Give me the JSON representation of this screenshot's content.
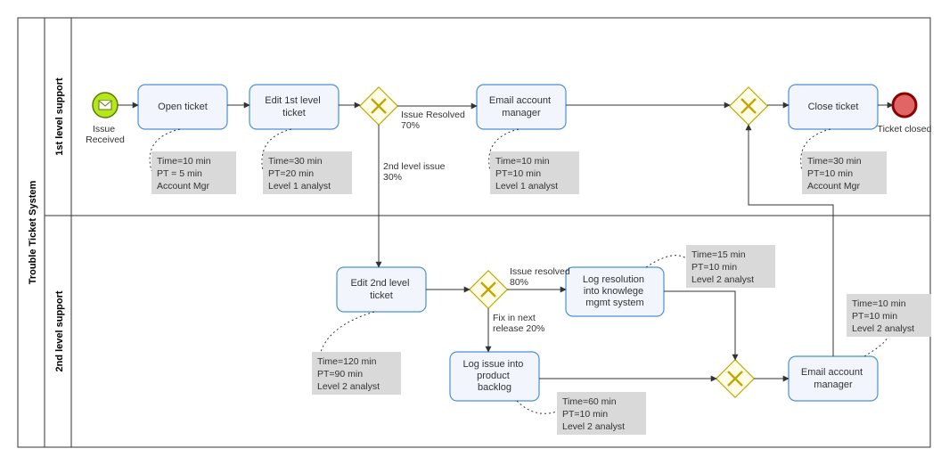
{
  "pool_title": "Trouble Ticket System",
  "lanes": {
    "l1": "1st level support",
    "l2": "2nd level support"
  },
  "start_event": {
    "label": "Issue\nReceived"
  },
  "end_event": {
    "label": "Ticket closed"
  },
  "tasks": {
    "open": {
      "label": "Open ticket",
      "anno": [
        "Time=10 min",
        "PT = 5 min",
        "Account Mgr"
      ]
    },
    "edit1": {
      "label": "Edit 1st level\nticket",
      "anno": [
        "Time=30 min",
        "PT=20 min",
        "Level 1 analyst"
      ]
    },
    "email1": {
      "label": "Email account\nmanager",
      "anno": [
        "Time=10 min",
        "PT=10 min",
        "Level 1 analyst"
      ]
    },
    "close": {
      "label": "Close ticket",
      "anno": [
        "Time=30 min",
        "PT=10 min",
        "Account Mgr"
      ]
    },
    "edit2": {
      "label": "Edit 2nd level\nticket",
      "anno": [
        "Time=120 min",
        "PT=90 min",
        "Level 2 analyst"
      ]
    },
    "logres": {
      "label": "Log resolution\ninto knowlege\nmgmt system",
      "anno": [
        "Time=15 min",
        "PT=10 min",
        "Level 2 analyst"
      ]
    },
    "logbk": {
      "label": "Log issue into\nproduct\nbacklog",
      "anno": [
        "Time=60 min",
        "PT=10 min",
        "Level 2 analyst"
      ]
    },
    "email2": {
      "label": "Email account\nmanager",
      "anno": [
        "Time=10 min",
        "PT=10 min",
        "Level 2 analyst"
      ]
    }
  },
  "edges": {
    "g1_resolved": "Issue Resolved\n70%",
    "g1_2ndlevel": "2nd level issue\n30%",
    "g2_resolved": "Issue resolved\n80%",
    "g2_fixnext": "Fix in next\nrelease 20%"
  }
}
